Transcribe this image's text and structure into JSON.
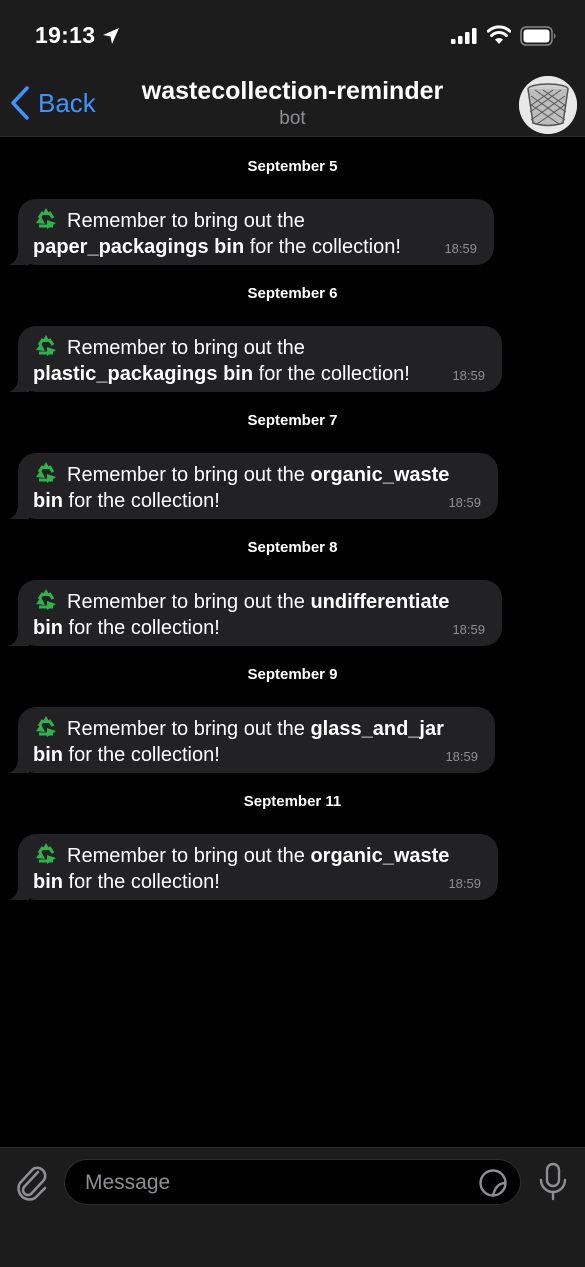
{
  "status_bar": {
    "time": "19:13"
  },
  "header": {
    "back_label": "Back",
    "title": "wastecollection-reminder",
    "subtitle": "bot",
    "avatar_icon": "wastebasket-icon"
  },
  "colors": {
    "accent": "#3e94ff",
    "bubble": "#222224",
    "background": "#000000",
    "bar": "#1c1c1d"
  },
  "messages": [
    {
      "date": "September 5",
      "prefix": "Remember to bring out the",
      "bold": "paper_packagings bin",
      "suffix": " for the collection!",
      "time": "18:59"
    },
    {
      "date": "September 6",
      "prefix": "Remember to bring out the",
      "bold": "plastic_packagings bin",
      "suffix": " for the collection!",
      "time": "18:59"
    },
    {
      "date": "September 7",
      "prefix": "Remember to bring out the ",
      "bold": "organic_waste",
      "bold2": "bin",
      "suffix": " for the collection!",
      "time": "18:59"
    },
    {
      "date": "September 8",
      "prefix": "Remember to bring out the ",
      "bold": "undifferentiate",
      "bold2": "bin",
      "suffix": " for the collection!",
      "time": "18:59"
    },
    {
      "date": "September 9",
      "prefix": "Remember to bring out the ",
      "bold": "glass_and_jar",
      "bold2": "bin",
      "suffix": " for the collection!",
      "time": "18:59"
    },
    {
      "date": "September 11",
      "prefix": "Remember to bring out the ",
      "bold": "organic_waste",
      "bold2": "bin",
      "suffix": " for the collection!",
      "time": "18:59"
    }
  ],
  "input": {
    "placeholder": "Message"
  },
  "icons": [
    "location-arrow-icon",
    "signal-icon",
    "wifi-icon",
    "battery-icon",
    "chevron-left-icon",
    "recycle-icon",
    "paperclip-icon",
    "sticker-icon",
    "microphone-icon"
  ]
}
